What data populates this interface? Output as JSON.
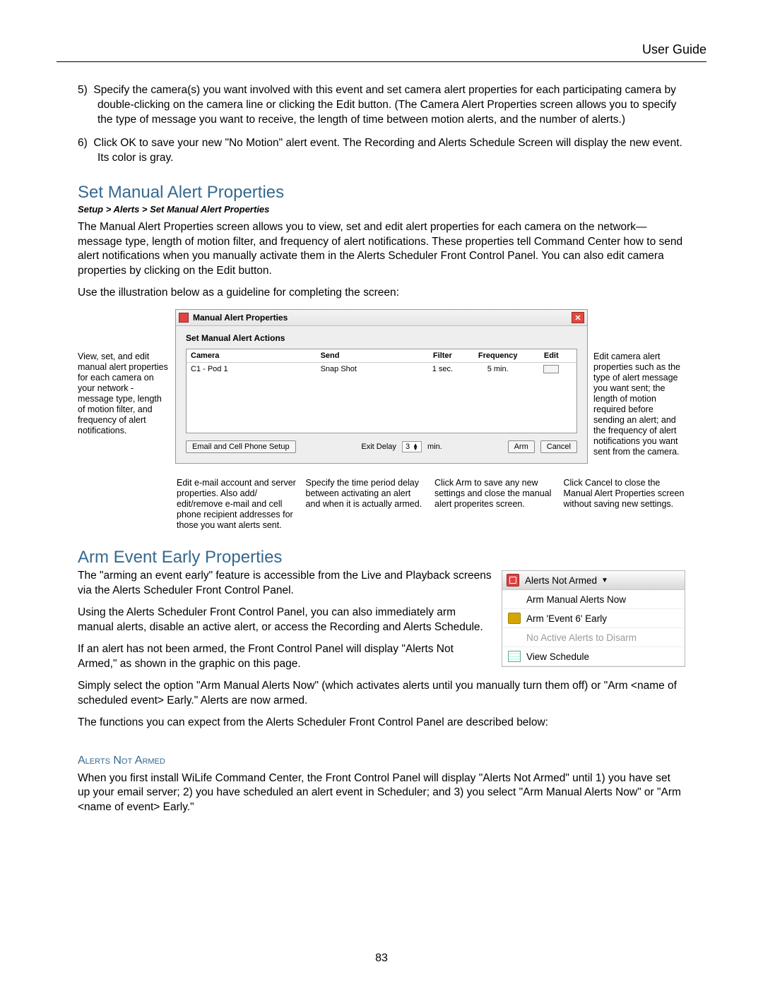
{
  "header": {
    "title": "User Guide"
  },
  "numbered_prefix_start": 5,
  "list_items": [
    "Specify the camera(s) you want involved with this event and set camera alert properties for each participating camera by double-clicking on the camera line or clicking the Edit button.  (The Camera Alert Properties screen allows you to specify the type of message you want to receive, the length of time between motion alerts, and the number of alerts.)",
    "Click OK to save your new \"No Motion\" alert event. The Recording and Alerts Schedule Screen will display the new event. Its color is gray."
  ],
  "section1": {
    "title": "Set Manual Alert Properties",
    "breadcrumb": "Setup > Alerts > Set Manual Alert Properties",
    "p1": "The Manual Alert Properties screen allows you to view, set and edit alert properties for each camera on the network—message type, length of motion filter, and frequency of alert notifications.  These properties tell Command Center how to send alert notifications when you manually activate them in the Alerts Scheduler Front Control Panel.  You can also edit camera properties by clicking on the Edit button.",
    "p2": "Use the illustration below as a guideline for completing the screen:"
  },
  "dialog": {
    "title": "Manual Alert Properties",
    "subtitle": "Set Manual Alert Actions",
    "headers": {
      "camera": "Camera",
      "send": "Send",
      "filter": "Filter",
      "frequency": "Frequency",
      "edit": "Edit"
    },
    "row": {
      "camera": "C1 - Pod 1",
      "send": "Snap Shot",
      "filter": "1 sec.",
      "frequency": "5 min."
    },
    "buttons": {
      "email": "Email and Cell Phone Setup",
      "exit_label": "Exit Delay",
      "exit_value": "3",
      "exit_unit": "min.",
      "arm": "Arm",
      "cancel": "Cancel"
    }
  },
  "callouts": {
    "left": "View, set, and edit manual alert properties for each camera on your network - message type, length of motion filter, and frequency of alert notifications.",
    "right": "Edit camera alert properties such as the type of alert message you want sent; the length of motion required before sending an alert; and the frequency of alert notifications you want sent from the camera.",
    "under_email": "Edit e-mail account and server properties. Also add/ edit/remove e-mail and cell phone recipient addresses for those you want alerts sent.",
    "under_delay": "Specify the time period delay between activating an alert and when it is actually armed.",
    "under_arm": "Click Arm to save any new settings and close the manual alert properites screen.",
    "under_cancel": "Click Cancel to close the Manual Alert Properties screen without saving new settings."
  },
  "section2": {
    "title": "Arm Event Early Properties",
    "p1": "The \"arming an event early\" feature is accessible from the Live and Playback screens via the Alerts Scheduler Front Control Panel.",
    "p2": "Using the Alerts Scheduler Front Control Panel, you can also immediately arm manual alerts, disable an active alert, or access the Recording and Alerts Schedule.",
    "p3": "If an alert has not been armed, the Front Control Panel will display \"Alerts Not Armed,\" as shown in the graphic on this page.",
    "p4": "Simply select the option \"Arm Manual Alerts Now\" (which activates alerts until you manually turn them off) or \"Arm <name of scheduled event> Early.\"  Alerts are now armed.",
    "p5": "The functions you can expect from the Alerts Scheduler Front Control Panel are described below:"
  },
  "panel": {
    "head": "Alerts Not Armed",
    "items": [
      {
        "label": "Arm Manual Alerts Now",
        "disabled": false
      },
      {
        "label": "Arm 'Event 6' Early",
        "disabled": false,
        "icon": "badge"
      },
      {
        "label": "No Active Alerts to Disarm",
        "disabled": true
      },
      {
        "label": "View Schedule",
        "disabled": false,
        "icon": "sched"
      }
    ]
  },
  "sub": {
    "title": "Alerts Not Armed",
    "p": "When you first install WiLife Command Center, the Front Control Panel will display \"Alerts Not Armed\" until 1) you have set up your email server; 2) you have scheduled an alert event in Scheduler; and 3) you select \"Arm Manual Alerts Now\" or \"Arm <name of event> Early.\""
  },
  "page_number": "83"
}
